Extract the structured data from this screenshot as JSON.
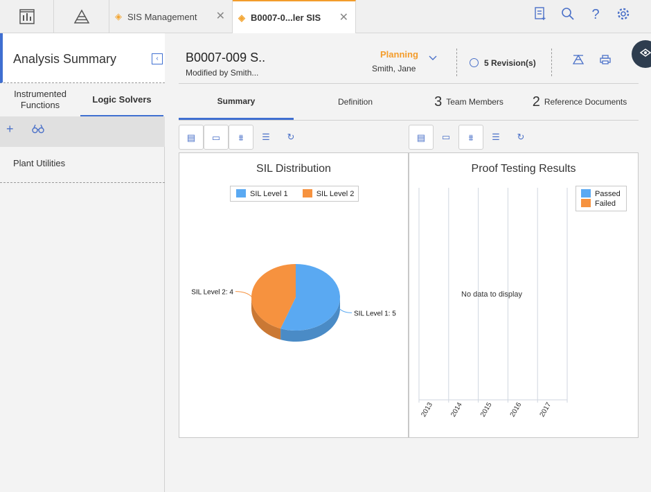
{
  "topbar": {
    "tabs": [
      {
        "label": "SIS Management",
        "close": "✕"
      },
      {
        "label": "B0007-0...ler SIS",
        "close": "✕"
      }
    ]
  },
  "left_panel": {
    "title": "Analysis Summary",
    "collapse_glyph": "‹",
    "tabs": [
      "Instrumented Functions",
      "Logic Solvers"
    ],
    "add_glyph": "+",
    "items": [
      "Plant Utilities"
    ]
  },
  "header": {
    "code": "B0007-009 S..",
    "modified": "Modified by Smith...",
    "state": "Planning",
    "owner": "Smith, Jane",
    "revisions": "5 Revision(s)"
  },
  "subtabs": [
    {
      "count": "",
      "label": "Summary"
    },
    {
      "count": "",
      "label": "Definition"
    },
    {
      "count": "3",
      "label": "Team Members"
    },
    {
      "count": "2",
      "label": "Reference Documents"
    }
  ],
  "sil_chart": {
    "title": "SIL Distribution",
    "chart_data": {
      "type": "pie",
      "title": "SIL Distribution",
      "categories": [
        "SIL Level 1",
        "SIL Level 2"
      ],
      "values": [
        5,
        4
      ],
      "labels": [
        "SIL Level 1: 5",
        "SIL Level 2: 4"
      ],
      "colors": [
        "#5aa9f2",
        "#f6923f"
      ],
      "legend_position": "top-center"
    }
  },
  "proof_chart": {
    "title": "Proof Testing Results",
    "no_data": "No data to display",
    "chart_data": {
      "type": "bar",
      "title": "Proof Testing Results",
      "categories": [
        "2013",
        "2014",
        "2015",
        "2016",
        "2017"
      ],
      "series": [
        {
          "name": "Passed",
          "values": []
        },
        {
          "name": "Failed",
          "values": []
        }
      ],
      "colors": [
        "#5aa9f2",
        "#f6923f"
      ],
      "legend_position": "top-right"
    }
  }
}
